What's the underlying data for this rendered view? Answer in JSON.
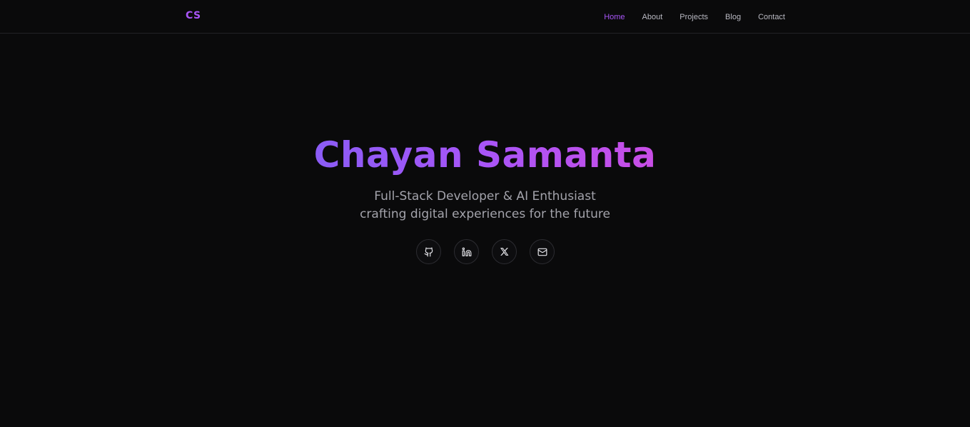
{
  "header": {
    "logo": "CS",
    "nav": [
      {
        "label": "Home",
        "active": true
      },
      {
        "label": "About",
        "active": false
      },
      {
        "label": "Projects",
        "active": false
      },
      {
        "label": "Blog",
        "active": false
      },
      {
        "label": "Contact",
        "active": false
      }
    ]
  },
  "hero": {
    "name": "Chayan Samanta",
    "tagline_line1": "Full-Stack Developer & AI Enthusiast",
    "tagline_line2": "crafting digital experiences for the future"
  },
  "socials": [
    {
      "icon": "github-icon"
    },
    {
      "icon": "linkedin-icon"
    },
    {
      "icon": "x-icon"
    },
    {
      "icon": "mail-icon"
    }
  ],
  "colors": {
    "background": "#0a0a0b",
    "accent": "#a855f7",
    "gradient_start": "#8b5cf6",
    "gradient_end": "#c94ee6",
    "nav_text": "#b9b9c2",
    "tagline_text": "#a3a3ab"
  }
}
